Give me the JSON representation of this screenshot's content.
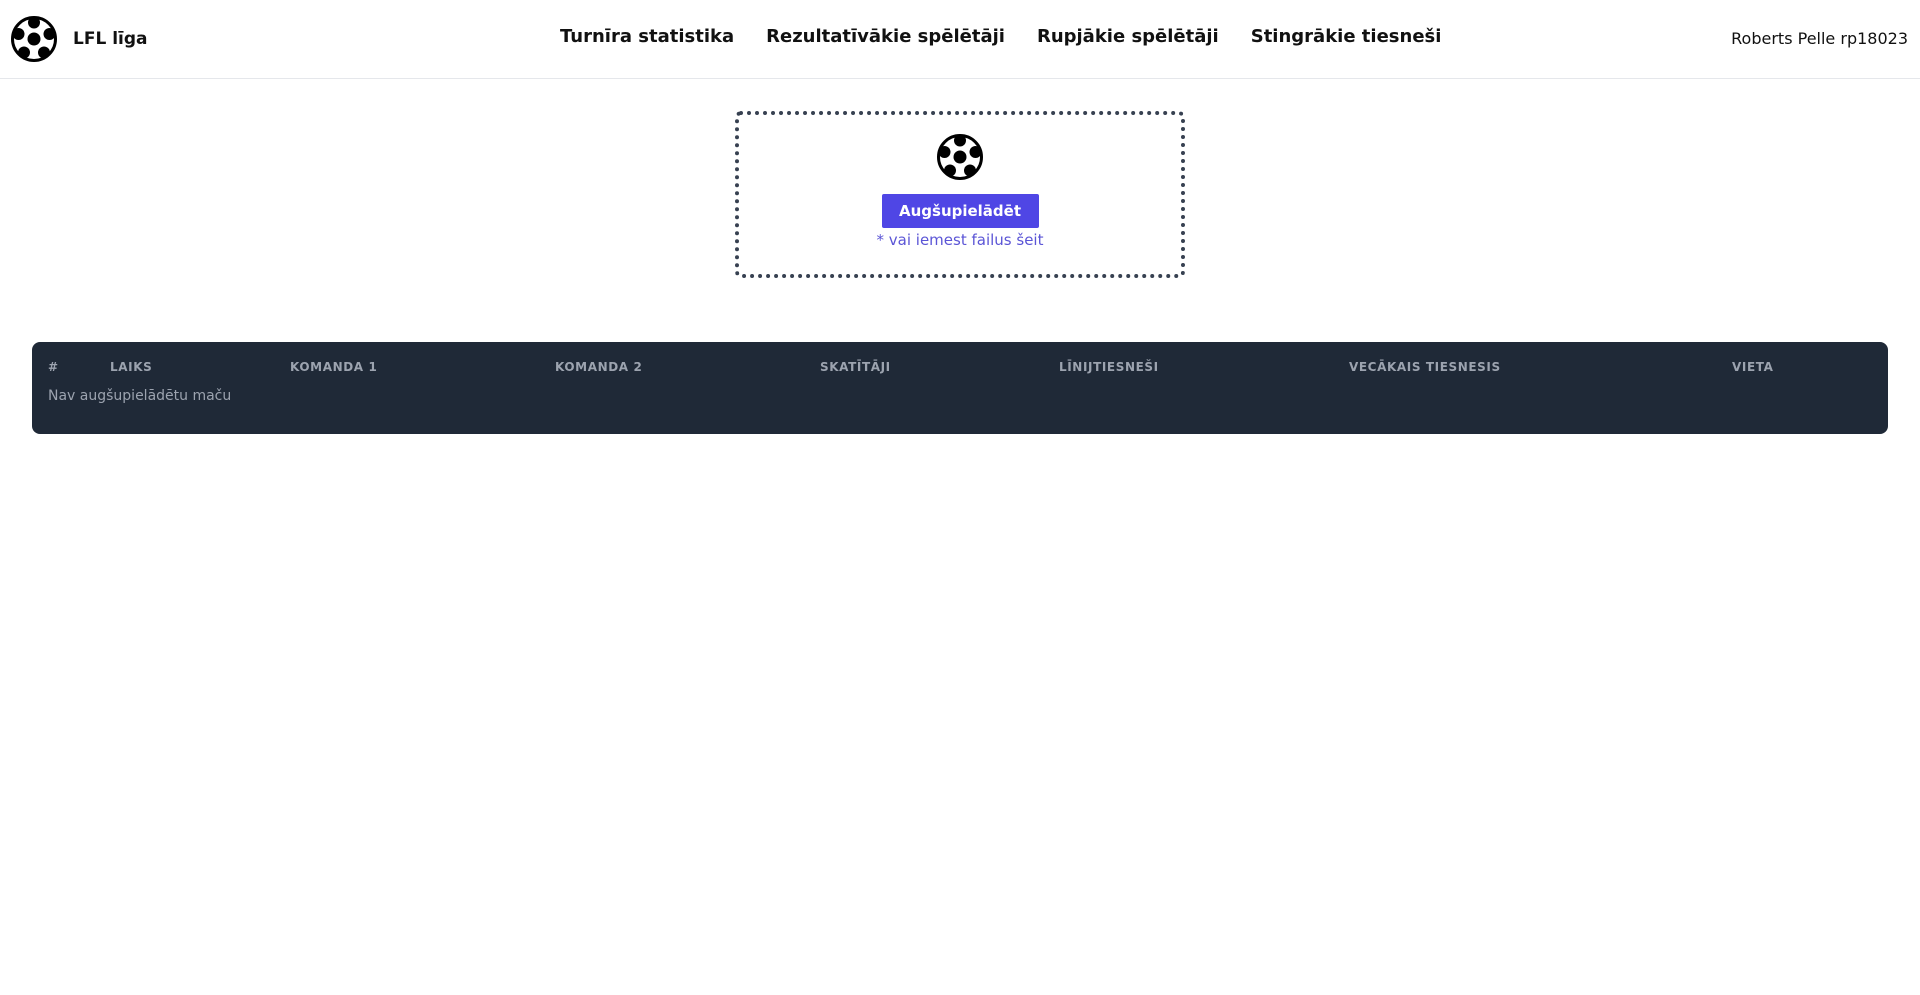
{
  "header": {
    "brand": {
      "name": "LFL līga",
      "icon": "soccer-ball-icon"
    },
    "nav": [
      {
        "label": "Turnīra statistika"
      },
      {
        "label": "Rezultatīvākie spēlētāji"
      },
      {
        "label": "Rupjākie spēlētāji"
      },
      {
        "label": "Stingrākie tiesneši"
      }
    ],
    "user": "Roberts Pelle rp18023"
  },
  "upload": {
    "icon": "soccer-ball-icon",
    "button_label": "Augšupielādēt",
    "hint": "* vai iemest failus šeit",
    "accent_color": "#4f46e5"
  },
  "matches_table": {
    "columns": [
      "#",
      "Laiks",
      "Komanda 1",
      "Komanda 2",
      "Skatītāji",
      "Līnijtiesneši",
      "Vecākais tiesnesis",
      "Vieta"
    ],
    "empty_message": "Nav augšupielādētu maču",
    "background_color": "#1f2937"
  }
}
